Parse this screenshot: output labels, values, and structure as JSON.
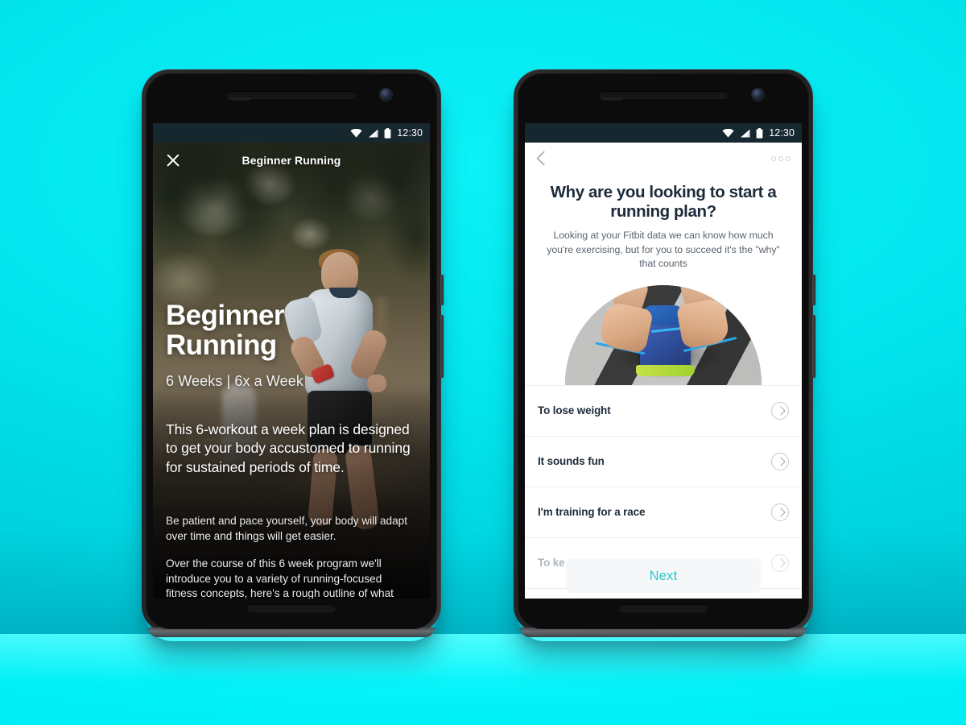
{
  "background": {
    "color_wall": "#00e0ea",
    "color_floor": "#00f0f8"
  },
  "phones": {
    "left": {
      "status_bar": {
        "time": "12:30",
        "icons": [
          "wifi-icon",
          "signal-icon",
          "battery-icon"
        ]
      },
      "header": {
        "close_label": "×",
        "title": "Beginner Running"
      },
      "hero": {
        "title_line1": "Beginner",
        "title_line2": "Running",
        "meta": "6 Weeks  |  6x a Week",
        "lede": "This 6-workout a week plan is designed to get your body accustomed to running for sustained periods of time.",
        "paragraph_1": "Be patient and pace yourself, your body will adapt over time and things will get easier.",
        "paragraph_2": "Over the course of this 6 week program we'll introduce you to a variety of running-focused fitness concepts, here's a rough outline of what"
      }
    },
    "right": {
      "status_bar": {
        "time": "12:30",
        "icons": [
          "wifi-icon",
          "signal-icon",
          "battery-icon"
        ]
      },
      "appbar": {
        "back_icon": "back-chevron-icon",
        "overflow_icon": "overflow-dots-icon"
      },
      "question": {
        "title": "Why are you looking to start a running plan?",
        "subtitle": "Looking at your Fitbit data we can know how much you're exercising, but for you to succeed it's the \"why\" that counts"
      },
      "options": [
        {
          "label": "To lose weight",
          "dim": false
        },
        {
          "label": "It sounds fun",
          "dim": false
        },
        {
          "label": "I'm training for a race",
          "dim": false
        },
        {
          "label": "To ke",
          "dim": true
        }
      ],
      "next_button": {
        "label": "Next",
        "color": "#2ec6c6"
      }
    }
  }
}
